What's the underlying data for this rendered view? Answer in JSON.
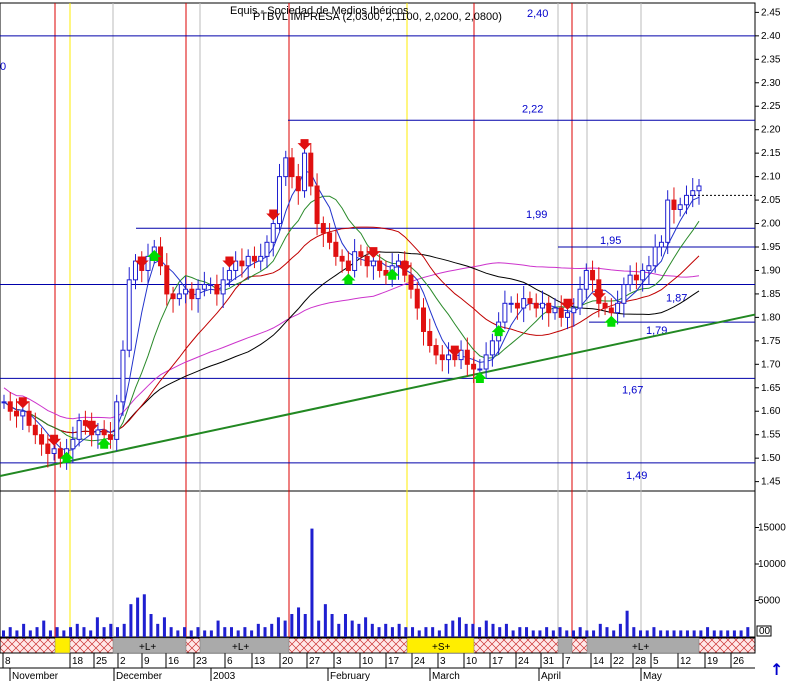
{
  "header": {
    "title_line_1": "Equis - Sociedad de Medios Ibéricos",
    "title_line_2": "PTBVL IMPRESA (2,0300, 2,1100, 2,0200, 2,0800)",
    "top_label": "2,40",
    "left_label": "0"
  },
  "chart_data": {
    "type": "candlestick",
    "title": "PTBVL IMPRESA (2,0300, 2,1100, 2,0200, 2,0800)",
    "price_axis": {
      "ylim": [
        1.43,
        2.47
      ],
      "ticks": [
        "2.45",
        "2.40",
        "2.35",
        "2.30",
        "2.25",
        "2.20",
        "2.15",
        "2.10",
        "2.05",
        "2.00",
        "1.95",
        "1.90",
        "1.85",
        "1.80",
        "1.75",
        "1.70",
        "1.65",
        "1.60",
        "1.55",
        "1.50",
        "1.45"
      ]
    },
    "volume_axis": {
      "ticks": [
        "15000",
        "10000",
        "5000"
      ]
    },
    "x_ticks": [
      "8",
      "18",
      "25",
      "2",
      "9",
      "16",
      "23",
      "6",
      "13",
      "20",
      "27",
      "3",
      "10",
      "17",
      "24",
      "3",
      "10",
      "17",
      "24",
      "31",
      "7",
      "14",
      "22",
      "28",
      "5",
      "12",
      "19",
      "26"
    ],
    "months": [
      "November",
      "December",
      "2003",
      "February",
      "March",
      "April",
      "May"
    ],
    "horizontal_levels": [
      {
        "value": 2.4,
        "label": "2,40"
      },
      {
        "value": 2.22,
        "label": "2,22"
      },
      {
        "value": 1.99,
        "label": "1,99"
      },
      {
        "value": 1.95,
        "label": "1,95"
      },
      {
        "value": 1.87,
        "label": "1,87"
      },
      {
        "value": 1.79,
        "label": "1,79"
      },
      {
        "value": 1.67,
        "label": "1,67"
      },
      {
        "value": 1.49,
        "label": "1,49"
      }
    ],
    "trendline": {
      "from": [
        -5,
        1.455
      ],
      "to": [
        160,
        1.805
      ]
    },
    "event_labels": [
      "+L+",
      "+L+",
      "+S+",
      "+L+"
    ],
    "closes": [
      1.62,
      1.6,
      1.59,
      1.6,
      1.57,
      1.55,
      1.53,
      1.51,
      1.52,
      1.5,
      1.52,
      1.54,
      1.58,
      1.57,
      1.55,
      1.56,
      1.55,
      1.54,
      1.62,
      1.73,
      1.88,
      1.92,
      1.9,
      1.93,
      1.95,
      1.91,
      1.85,
      1.84,
      1.85,
      1.86,
      1.84,
      1.86,
      1.87,
      1.87,
      1.85,
      1.88,
      1.9,
      1.92,
      1.91,
      1.93,
      1.92,
      1.93,
      1.96,
      2.0,
      2.1,
      2.14,
      2.1,
      2.07,
      2.15,
      2.08,
      2.0,
      1.98,
      1.96,
      1.93,
      1.92,
      1.9,
      1.94,
      1.93,
      1.91,
      1.92,
      1.9,
      1.89,
      1.91,
      1.92,
      1.89,
      1.86,
      1.82,
      1.77,
      1.74,
      1.72,
      1.71,
      1.72,
      1.71,
      1.73,
      1.7,
      1.69,
      1.69,
      1.72,
      1.75,
      1.79,
      1.83,
      1.83,
      1.82,
      1.84,
      1.83,
      1.82,
      1.83,
      1.81,
      1.82,
      1.8,
      1.81,
      1.82,
      1.86,
      1.9,
      1.88,
      1.83,
      1.82,
      1.81,
      1.83,
      1.87,
      1.89,
      1.88,
      1.9,
      1.91,
      1.95,
      1.96,
      2.05,
      2.03,
      2.04,
      2.06,
      2.07,
      2.08
    ],
    "volume_bars": [
      2,
      3,
      2,
      4,
      2,
      3,
      5,
      2,
      3,
      2,
      3,
      4,
      3,
      2,
      6,
      3,
      4,
      3,
      4,
      10,
      12,
      13,
      7,
      4,
      6,
      3,
      2,
      3,
      2,
      3,
      2,
      2,
      5,
      3,
      3,
      2,
      3,
      2,
      4,
      3,
      4,
      6,
      5,
      7,
      9,
      7,
      33,
      5,
      10,
      7,
      4,
      7,
      5,
      4,
      6,
      4,
      3,
      4,
      3,
      4,
      3,
      3,
      2,
      3,
      3,
      2,
      4,
      5,
      6,
      4,
      4,
      3,
      5,
      4,
      3,
      4,
      2,
      3,
      3,
      2,
      2,
      3,
      2,
      3,
      2,
      2,
      3,
      2,
      2,
      4,
      3,
      2,
      4,
      8,
      3,
      2,
      2,
      3,
      2,
      2,
      2,
      2,
      2,
      2,
      2,
      3,
      2,
      2,
      2,
      2,
      2,
      3
    ]
  },
  "colors": {
    "price_up": "#1f1fd0",
    "price_down": "#e01010",
    "ma_red": "#c00000",
    "ma_blue": "#2233cc",
    "ma_green": "#2a8a2a",
    "ma_black": "#000000",
    "ma_magenta": "#cc33cc",
    "support_line": "#228822",
    "level_line": "#0000aa",
    "event_red": "#dd0000",
    "event_yellow": "#ffee00",
    "event_grey": "#aaaaaa"
  },
  "footer": {
    "scroll_arrow_label": "↑",
    "counter_label": "00"
  }
}
